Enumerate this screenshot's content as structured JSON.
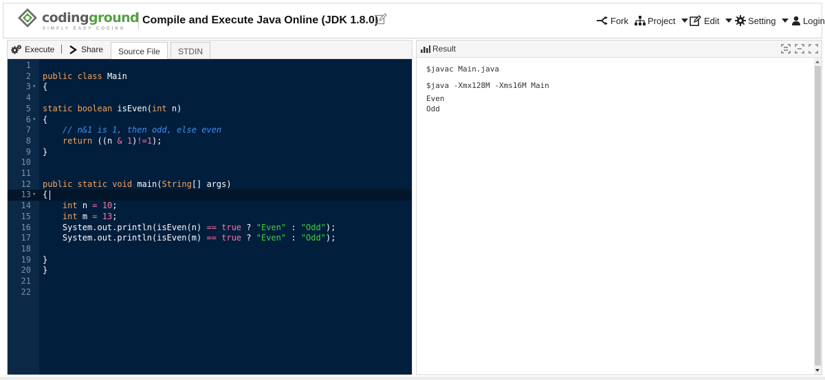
{
  "header": {
    "logo_word_a": "coding",
    "logo_word_b": "ground",
    "logo_tagline": "SIMPLY EASY CODING",
    "title": "Compile and Execute Java Online (JDK 1.8.0)",
    "menu": {
      "fork": "Fork",
      "project": "Project",
      "edit": "Edit",
      "setting": "Setting",
      "login": "Login"
    }
  },
  "toolbar": {
    "execute": "Execute",
    "share": "Share",
    "tabs": [
      "Source File",
      "STDIN"
    ]
  },
  "editor": {
    "line_numbers": [
      "1",
      "2",
      "3",
      "4",
      "5",
      "6",
      "7",
      "8",
      "9",
      "10",
      "11",
      "12",
      "13",
      "14",
      "15",
      "16",
      "17",
      "18",
      "19",
      "20",
      "21",
      "22"
    ],
    "lines": {
      "l2": [
        "public",
        "class",
        "Main"
      ],
      "l3": [
        "{"
      ],
      "l5": [
        "static",
        "boolean",
        "isEven(",
        "int",
        "n)"
      ],
      "l6": [
        "{"
      ],
      "l7": [
        "// n&1 is 1, then odd, else even"
      ],
      "l8": [
        "return",
        "((n",
        "&",
        "1",
        ")",
        "!=",
        "1",
        ");"
      ],
      "l9": [
        "}"
      ],
      "l12": [
        "public",
        "static",
        "void",
        "main(",
        "String",
        "[] args)"
      ],
      "l13": [
        "{"
      ],
      "l14": [
        "int",
        "n",
        "=",
        "10",
        ";"
      ],
      "l15": [
        "int",
        "m",
        "=",
        "13",
        ";"
      ],
      "l16": [
        "System.out.println(isEven(n)",
        "==",
        "true",
        "?",
        "\"Even\"",
        ":",
        "\"Odd\"",
        ");"
      ],
      "l17": [
        "System.out.println(isEven(m)",
        "==",
        "true",
        "?",
        "\"Even\"",
        ":",
        "\"Odd\"",
        ");"
      ],
      "l19": [
        "}"
      ],
      "l20": [
        "}"
      ]
    }
  },
  "result": {
    "title": "Result",
    "output": [
      "$javac Main.java",
      "$java -Xmx128M -Xms16M Main",
      "Even",
      "Odd"
    ]
  },
  "colors": {
    "editor_bg": "#011e3c",
    "keyword": "#f5a35a",
    "comment": "#3f8ff0",
    "number": "#ff73a6",
    "string": "#3ed23e",
    "brand_green": "#55a044"
  },
  "icons": {
    "fork": "fork-icon",
    "project": "sitemap-icon",
    "edit": "edit-icon",
    "setting": "gear-icon",
    "login": "user-icon",
    "execute": "gears-icon",
    "share": "terminal-chevron-icon",
    "result": "bar-chart-icon"
  }
}
